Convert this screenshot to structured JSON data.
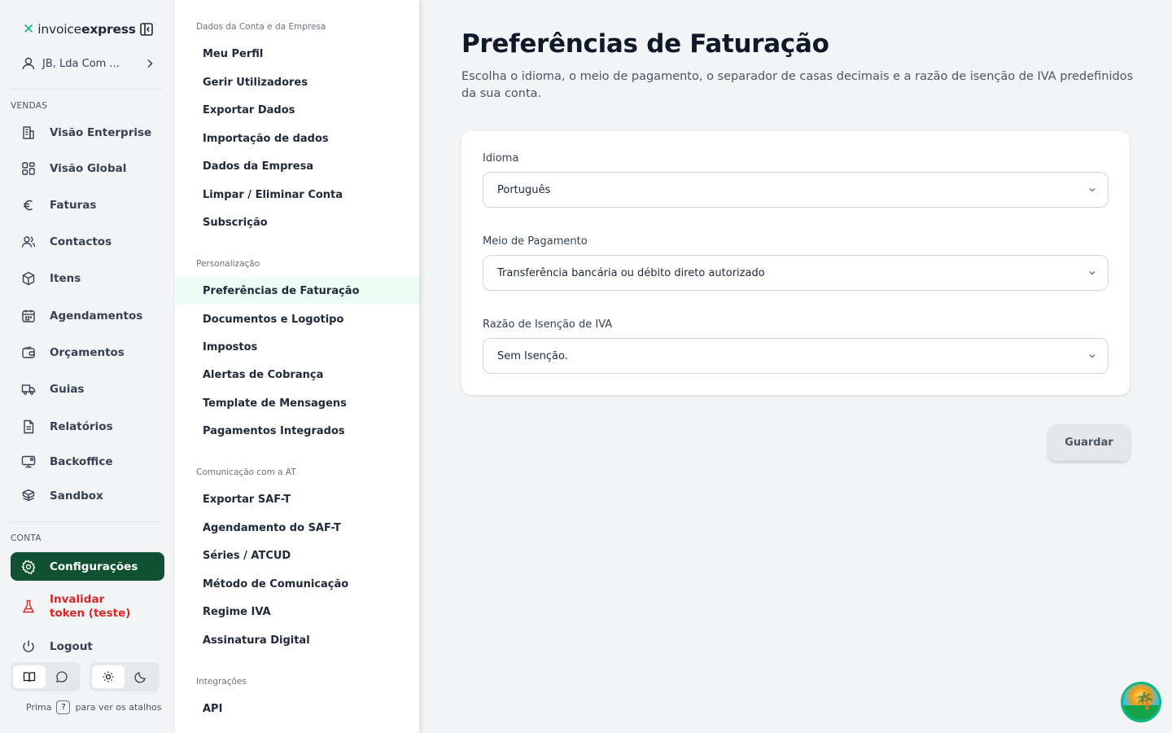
{
  "brand": {
    "mark": "✕",
    "name_light": "invoice",
    "name_bold": "express"
  },
  "account": {
    "label": "JB, Lda Com ..."
  },
  "sidebar": {
    "sections": {
      "sales": "VENDAS",
      "account": "CONTA"
    },
    "sales_items": [
      {
        "label": "Visão Enterprise",
        "icon": "building-icon"
      },
      {
        "label": "Visão Global",
        "icon": "dashboard-grid-icon"
      },
      {
        "label": "Faturas",
        "icon": "euro-icon"
      },
      {
        "label": "Contactos",
        "icon": "users-icon"
      },
      {
        "label": "Itens",
        "icon": "box-icon"
      },
      {
        "label": "Agendamentos",
        "icon": "calendar-icon"
      },
      {
        "label": "Orçamentos",
        "icon": "wallet-icon"
      },
      {
        "label": "Guias",
        "icon": "truck-icon"
      },
      {
        "label": "Relatórios",
        "icon": "report-icon"
      },
      {
        "label": "Backoffice",
        "icon": "monitor-icon"
      },
      {
        "label": "Sandbox",
        "icon": "boxes-icon"
      }
    ],
    "account_items": [
      {
        "label": "Configurações",
        "icon": "gear-icon",
        "active": true
      },
      {
        "label": "Invalidar token (teste)",
        "icon": "flask-icon"
      },
      {
        "label": "Logout",
        "icon": "power-icon"
      }
    ],
    "shortcut_hint": {
      "prefix": "Prima",
      "key": "?",
      "suffix": "para ver os atalhos"
    }
  },
  "submenu": {
    "sections": [
      {
        "title": "Dados da Conta e da Empresa",
        "items": [
          "Meu Perfil",
          "Gerir Utilizadores",
          "Exportar Dados",
          "Importação de dados",
          "Dados da Empresa",
          "Limpar / Eliminar Conta",
          "Subscrição"
        ]
      },
      {
        "title": "Personalização",
        "items": [
          "Preferências de Faturação",
          "Documentos e Logotipo",
          "Impostos",
          "Alertas de Cobrança",
          "Template de Mensagens",
          "Pagamentos Integrados"
        ]
      },
      {
        "title": "Comunicação com a AT",
        "items": [
          "Exportar SAF-T",
          "Agendamento do SAF-T",
          "Séries / ATCUD",
          "Método de Comunicação",
          "Regime IVA",
          "Assinatura Digital"
        ]
      },
      {
        "title": "Integrações",
        "items": [
          "API"
        ]
      }
    ],
    "active_item": "Preferências de Faturação"
  },
  "main": {
    "title": "Preferências de Faturação",
    "description": "Escolha o idioma, o meio de pagamento, o separador de casas decimais e a razão de isenção de IVA predefinidos da sua conta.",
    "fields": {
      "language": {
        "label": "Idioma",
        "value": "Português"
      },
      "payment": {
        "label": "Meio de Pagamento",
        "value": "Transferência bancária ou débito direto autorizado"
      },
      "vat_exemption": {
        "label": "Razão de Isenção de IVA",
        "value": "Sem Isenção."
      }
    },
    "save_label": "Guardar"
  },
  "colors": {
    "active_nav": "#0f5132",
    "accent": "#10b981",
    "danger": "#dc2626",
    "active_submenu_bg": "#ecfdf5"
  }
}
